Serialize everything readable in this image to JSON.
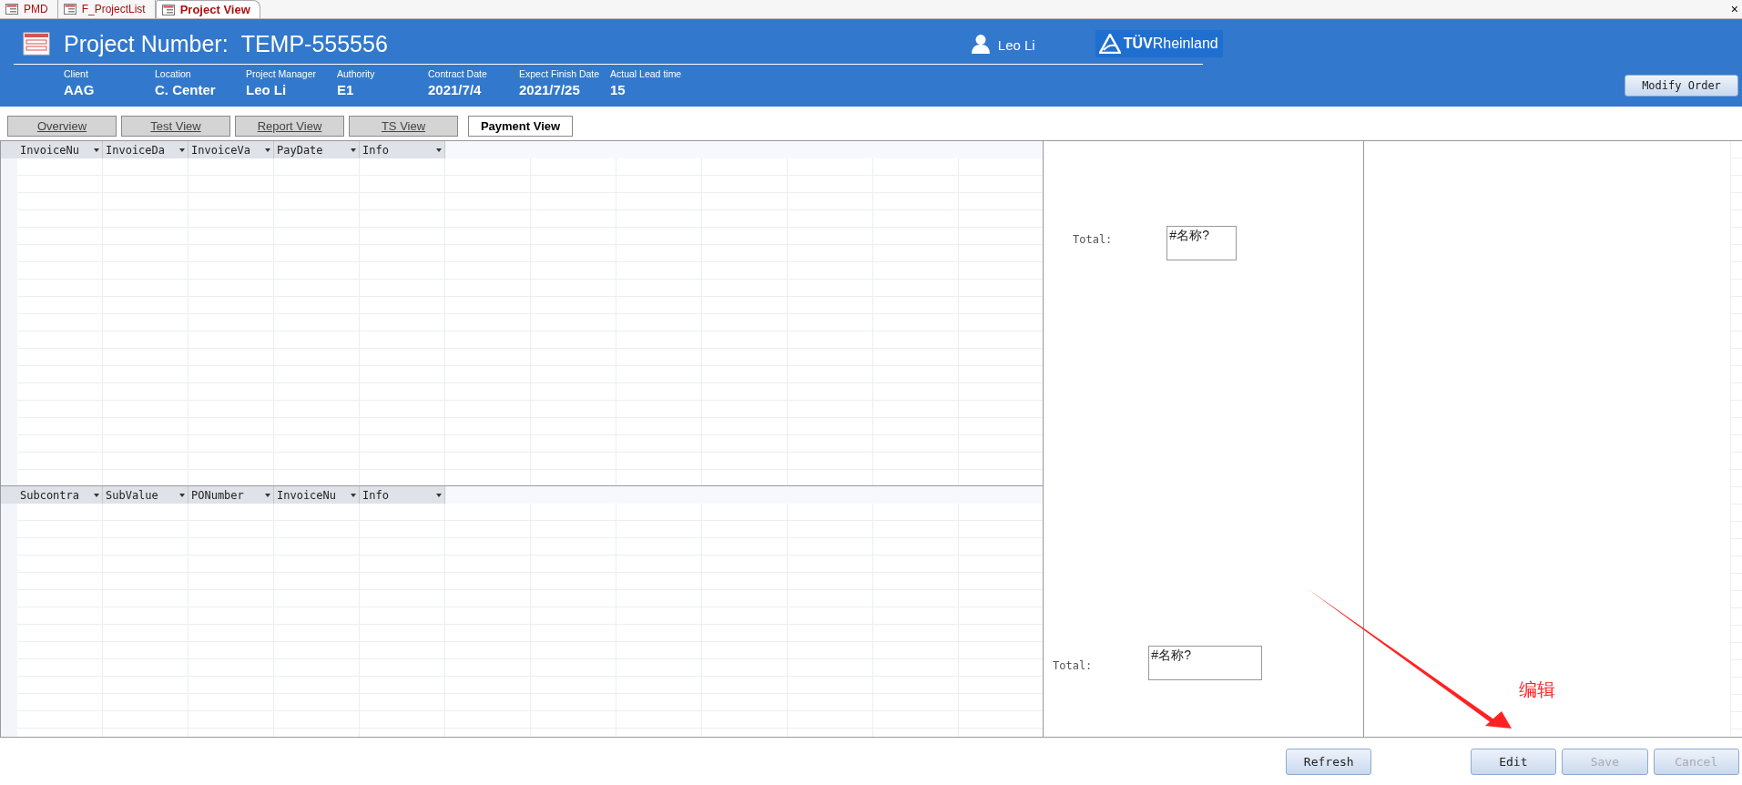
{
  "doc_tabs": [
    {
      "label": "PMD",
      "selected": false
    },
    {
      "label": "F_ProjectList",
      "selected": false
    },
    {
      "label": "Project View",
      "selected": true
    }
  ],
  "close_button": "×",
  "header": {
    "title_label": "Project Number:",
    "project_number": "TEMP-555556",
    "user": "Leo Li",
    "logo": "**TÜV**Rheinland"
  },
  "fields": [
    {
      "label": "Client",
      "value": "AAG"
    },
    {
      "label": "Location",
      "value": "C. Center"
    },
    {
      "label": "Project Manager",
      "value": "Leo Li"
    },
    {
      "label": "Authority",
      "value": "E1"
    },
    {
      "label": "Contract Date",
      "value": "2021/7/4"
    },
    {
      "label": "Expect Finish Date",
      "value": "2021/7/25"
    },
    {
      "label": "Actual Lead time",
      "value": "15"
    }
  ],
  "modify_order_button": "Modify Order",
  "view_tabs": [
    {
      "label": "Overview",
      "selected": false
    },
    {
      "label": "Test View",
      "selected": false
    },
    {
      "label": "Report View",
      "selected": false
    },
    {
      "label": "TS View",
      "selected": false
    },
    {
      "label": "Payment View",
      "selected": true
    }
  ],
  "invoice_table": {
    "columns": [
      "InvoiceNu",
      "InvoiceDa",
      "InvoiceVa",
      "PayDate",
      "Info"
    ]
  },
  "subcontract_table": {
    "columns": [
      "Subcontra",
      "SubValue",
      "PONumber",
      "InvoiceNu",
      "Info"
    ]
  },
  "totals": [
    {
      "label": "Total:",
      "value": "#名称?"
    },
    {
      "label": "Total:",
      "value": "#名称?"
    }
  ],
  "annotation": {
    "text": "编辑"
  },
  "buttons": [
    {
      "label": "Refresh",
      "disabled": false
    },
    {
      "label": "Edit",
      "disabled": false
    },
    {
      "label": "Save",
      "disabled": true
    },
    {
      "label": "Cancel",
      "disabled": true
    }
  ]
}
